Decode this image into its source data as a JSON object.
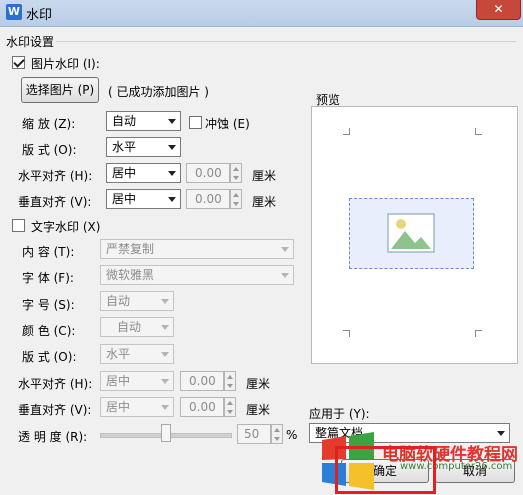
{
  "window": {
    "title": "水印",
    "app_icon": "W",
    "close_label": "✕"
  },
  "group": {
    "title": "水印设置"
  },
  "picture": {
    "checkbox_label": "图片水印 (I):",
    "checked": true,
    "select_button": "选择图片 (P)",
    "status": "( 已成功添加图片 )",
    "scale_label": "缩    放 (Z):",
    "scale_value": "自动",
    "washout_label": "冲蚀 (E)",
    "layout_label": "版    式 (O):",
    "layout_value": "水平",
    "halign_label": "水平对齐 (H):",
    "halign_value": "居中",
    "halign_offset": "0.00",
    "valign_label": "垂直对齐 (V):",
    "valign_value": "居中",
    "valign_offset": "0.00",
    "unit": "厘米"
  },
  "text": {
    "checkbox_label": "文字水印 (X)",
    "checked": false,
    "content_label": "内    容 (T):",
    "content_value": "严禁复制",
    "font_label": "字    体 (F):",
    "font_value": "微软雅黑",
    "size_label": "字    号 (S):",
    "size_value": "自动",
    "color_label": "颜    色 (C):",
    "color_value": "自动",
    "layout_label": "版    式 (O):",
    "layout_value": "水平",
    "halign_label": "水平对齐 (H):",
    "halign_value": "居中",
    "halign_offset": "0.00",
    "valign_label": "垂直对齐 (V):",
    "valign_value": "居中",
    "valign_offset": "0.00",
    "unit": "厘米",
    "transparency_label": "透 明 度 (R):",
    "transparency_value": "50",
    "transparency_unit": "%"
  },
  "preview": {
    "label": "预览"
  },
  "apply": {
    "label": "应用于 (Y):",
    "value": "整篇文档"
  },
  "buttons": {
    "ok": "确定",
    "cancel": "取消"
  },
  "overlay": {
    "site_name": "电脑软硬件教程网",
    "site_url": "www.computer26.com"
  },
  "colors": {
    "accent_red": "#e0211f",
    "title_bar": "#c9d9ec"
  }
}
